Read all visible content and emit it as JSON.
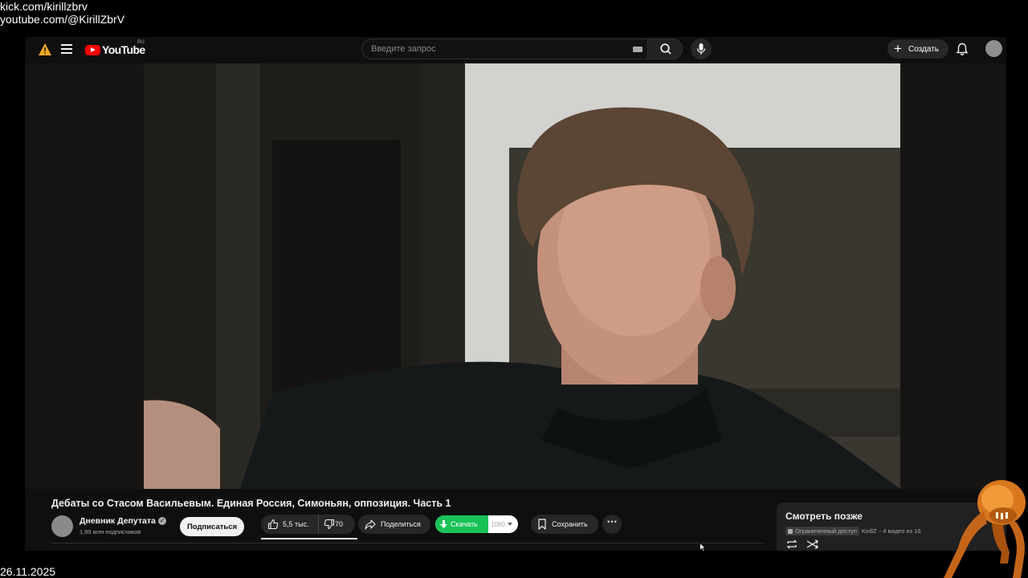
{
  "overlay": {
    "kick": "kick.com/kirillzbrv",
    "youtube": "youtube.com/@KirillZbrV",
    "date": "26.11.2025"
  },
  "topbar": {
    "logo_text": "YouTube",
    "country_code": "RU",
    "search_placeholder": "Введите запрос",
    "create_label": "Создать"
  },
  "video": {
    "title": "Дебаты со Стасом Васильевым. Единая Россия, Симоньян, оппозиция. Часть 1",
    "channel_name": "Дневник Депутата",
    "subscribers": "1,99 млн подписчиков",
    "subscribe_label": "Подписаться",
    "likes": "5,5 тыс.",
    "dislikes": "70",
    "share_label": "Поделиться",
    "download_label": "Скачать",
    "quality": "1080",
    "save_label": "Сохранить"
  },
  "playlist": {
    "title": "Смотреть позже",
    "access": "Ограниченный доступ",
    "owner": "KirillZ",
    "count": "- 4 видео из 16"
  },
  "icons": [
    "warning-icon",
    "menu-icon",
    "youtube-logo-icon",
    "keyboard-icon",
    "search-icon",
    "mic-icon",
    "plus-icon",
    "bell-icon",
    "verified-icon",
    "thumbs-up-icon",
    "thumbs-down-icon",
    "share-icon",
    "download-icon",
    "bookmark-icon",
    "more-icon",
    "lock-icon",
    "loop-icon",
    "shuffle-icon",
    "cursor-icon"
  ],
  "colors": {
    "background": "#0f0f0f",
    "youtube_red": "#ff0000",
    "download_green": "#19c257",
    "pill_bg": "#272727",
    "text": "#f1f1f1",
    "muted_text": "#aaaaaa"
  }
}
